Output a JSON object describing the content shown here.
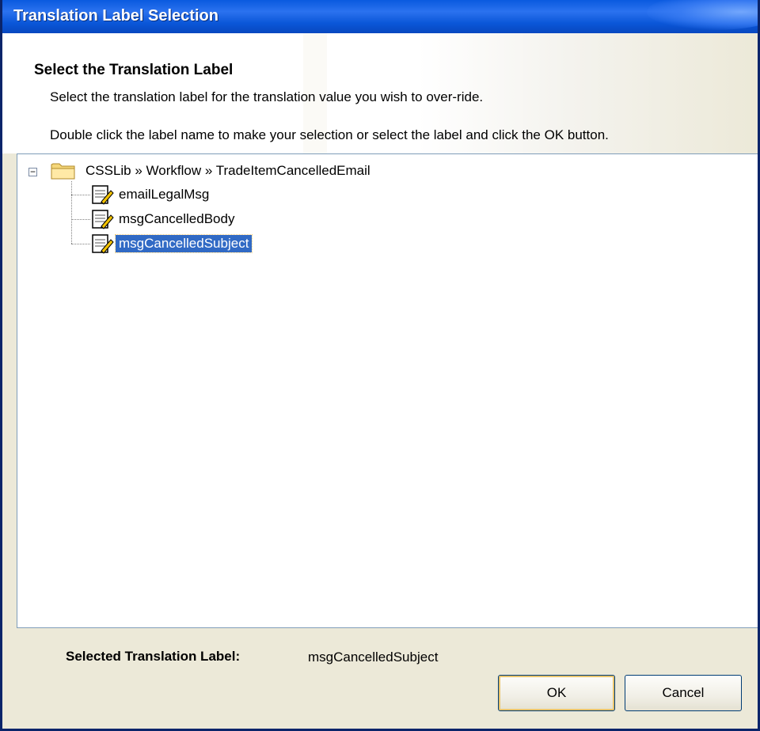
{
  "window": {
    "title": "Translation Label Selection"
  },
  "header": {
    "heading": "Select the Translation Label",
    "line1": "Select the translation label for the translation value you wish to over-ride.",
    "line2": "Double click the label name to make your selection or select the label and click the OK button."
  },
  "tree": {
    "root": {
      "toggle": "−",
      "label": "CSSLib » Workflow » TradeItemCancelledEmail",
      "icon": "folder-icon"
    },
    "items": [
      {
        "label": "emailLegalMsg",
        "icon": "document-edit-icon",
        "selected": false
      },
      {
        "label": "msgCancelledBody",
        "icon": "document-edit-icon",
        "selected": false
      },
      {
        "label": "msgCancelledSubject",
        "icon": "document-edit-icon",
        "selected": true
      }
    ]
  },
  "footer": {
    "selected_caption": "Selected Translation Label:",
    "selected_value": "msgCancelledSubject",
    "ok_label": "OK",
    "cancel_label": "Cancel"
  },
  "colors": {
    "titlebar": "#0a56d8",
    "selection": "#316ac5",
    "dialog_bg": "#ece9d8"
  }
}
